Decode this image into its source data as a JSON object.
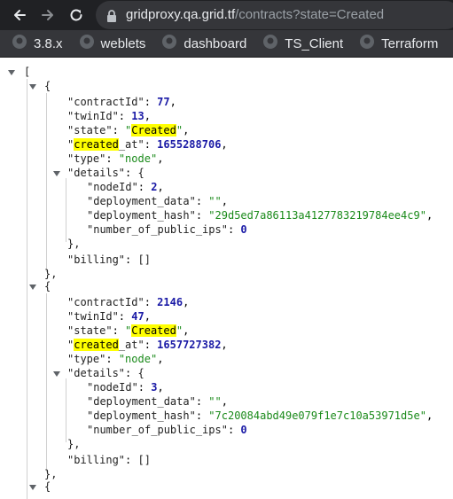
{
  "browser": {
    "url_host": "gridproxy.qa.grid.tf",
    "url_path": "/contracts?state=Created",
    "bookmarks": [
      "3.8.x",
      "weblets",
      "dashboard",
      "TS_Client",
      "Terraform"
    ]
  },
  "json_view": {
    "search_term": "Created",
    "contracts": [
      {
        "contractId": "77",
        "twinId": "13",
        "state": "Created",
        "created_at": "1655288706",
        "type": "node",
        "nodeId": "2",
        "deployment_data": "",
        "deployment_hash": "29d5ed7a86113a4127783219784ee4c9",
        "number_of_public_ips": "0",
        "billing": "[]"
      },
      {
        "contractId": "2146",
        "twinId": "47",
        "state": "Created",
        "created_at": "1657727382",
        "type": "node",
        "nodeId": "3",
        "deployment_data": "",
        "deployment_hash": "7c20084abd49e079f1e7c10a53971d5e",
        "number_of_public_ips": "0",
        "billing": "[]"
      }
    ]
  },
  "colors": {
    "toolbar": "#202124",
    "omnibox": "#35363a",
    "number": "#1a1aa6",
    "string": "#1a8a1a",
    "highlight": "#ffff00"
  }
}
